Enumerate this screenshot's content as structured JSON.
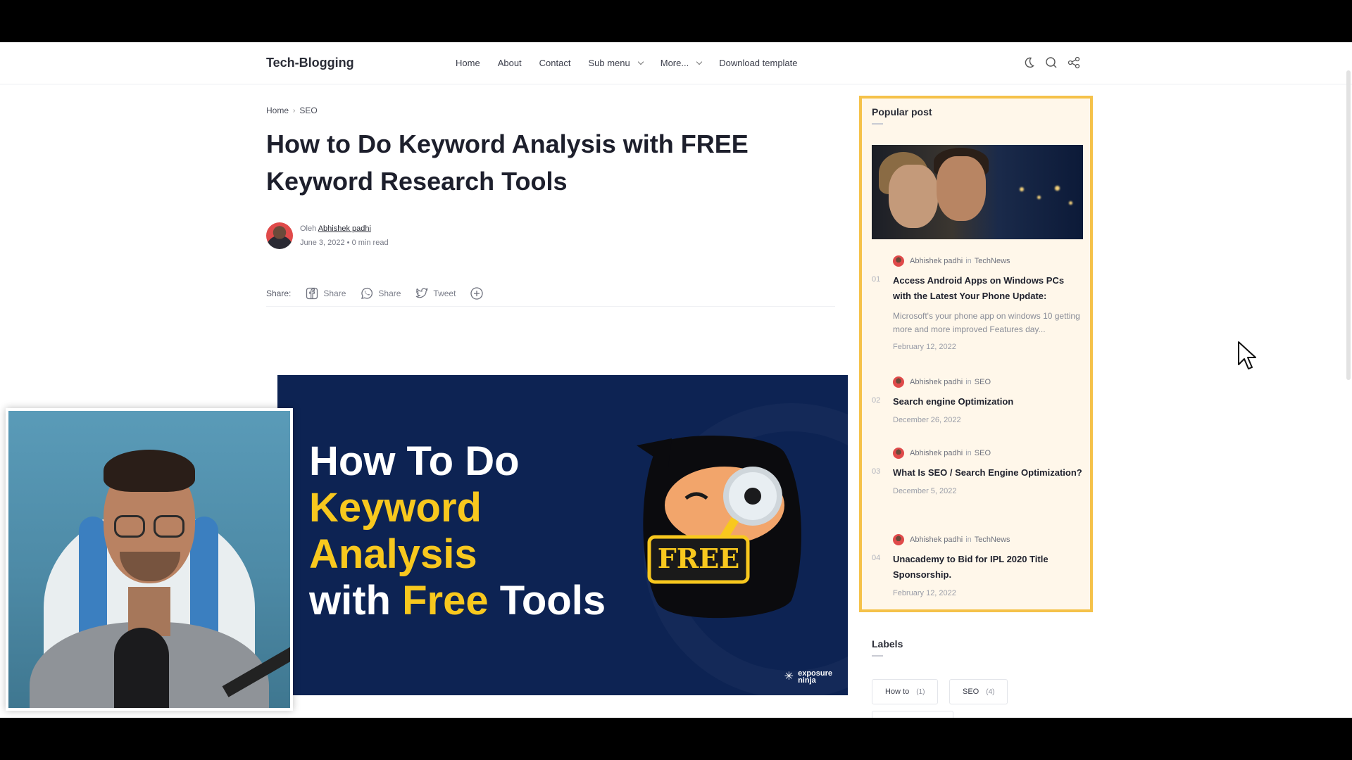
{
  "site": {
    "logo": "Tech-Blogging",
    "nav": [
      {
        "label": "Home",
        "has_dropdown": false
      },
      {
        "label": "About",
        "has_dropdown": false
      },
      {
        "label": "Contact",
        "has_dropdown": false
      },
      {
        "label": "Sub menu",
        "has_dropdown": true
      },
      {
        "label": "More...",
        "has_dropdown": true
      },
      {
        "label": "Download template",
        "has_dropdown": false
      }
    ],
    "header_icons": [
      "moon-icon",
      "search-icon",
      "share-icon"
    ]
  },
  "article": {
    "breadcrumb": [
      "Home",
      "SEO"
    ],
    "title_line1": "How to Do Keyword Analysis with FREE",
    "title_line2": "Keyword Research Tools",
    "author_prefix": "Oleh",
    "author_name": "Abhishek padhi",
    "date": "June 3, 2022",
    "read_time": "0 min read",
    "share_label": "Share:",
    "share_buttons": [
      {
        "icon": "facebook-icon",
        "label": "Share"
      },
      {
        "icon": "whatsapp-icon",
        "label": "Share"
      },
      {
        "icon": "twitter-icon",
        "label": "Tweet"
      },
      {
        "icon": "plus-circle-icon",
        "label": ""
      }
    ],
    "hero": {
      "line1": "How To Do",
      "line2": "Keyword",
      "line3": "Analysis",
      "line4_white": "with ",
      "line4_yellow": "Free",
      "line4_end": " Tools",
      "badge": "FREE",
      "brand_line1": "exposure",
      "brand_line2": "ninja"
    }
  },
  "sidebar": {
    "popular_title": "Popular post",
    "posts": [
      {
        "num": "01",
        "author": "Abhishek padhi",
        "in": "in",
        "category": "TechNews",
        "title": "Access Android Apps on Windows PCs with the Latest Your Phone Update:",
        "snippet": "Microsoft's your phone app on windows 10 getting more and more improved Features day...",
        "date": "February 12, 2022"
      },
      {
        "num": "02",
        "author": "Abhishek padhi",
        "in": "in",
        "category": "SEO",
        "title": "Search engine Optimization",
        "snippet": "",
        "date": "December 26, 2022"
      },
      {
        "num": "03",
        "author": "Abhishek padhi",
        "in": "in",
        "category": "SEO",
        "title": "What Is SEO / Search Engine Optimization?",
        "snippet": "",
        "date": "December 5, 2022"
      },
      {
        "num": "04",
        "author": "Abhishek padhi",
        "in": "in",
        "category": "TechNews",
        "title": "Unacademy to Bid for IPL 2020 Title Sponsorship.",
        "snippet": "",
        "date": "February 12, 2022"
      }
    ],
    "labels_title": "Labels",
    "labels": [
      {
        "name": "How to",
        "count": "(1)"
      },
      {
        "name": "SEO",
        "count": "(4)"
      }
    ]
  },
  "colors": {
    "hero_bg": "#0d2353",
    "hero_yellow": "#f8c81e",
    "popular_border": "#f5c24a",
    "popular_bg": "#fff7ea"
  }
}
